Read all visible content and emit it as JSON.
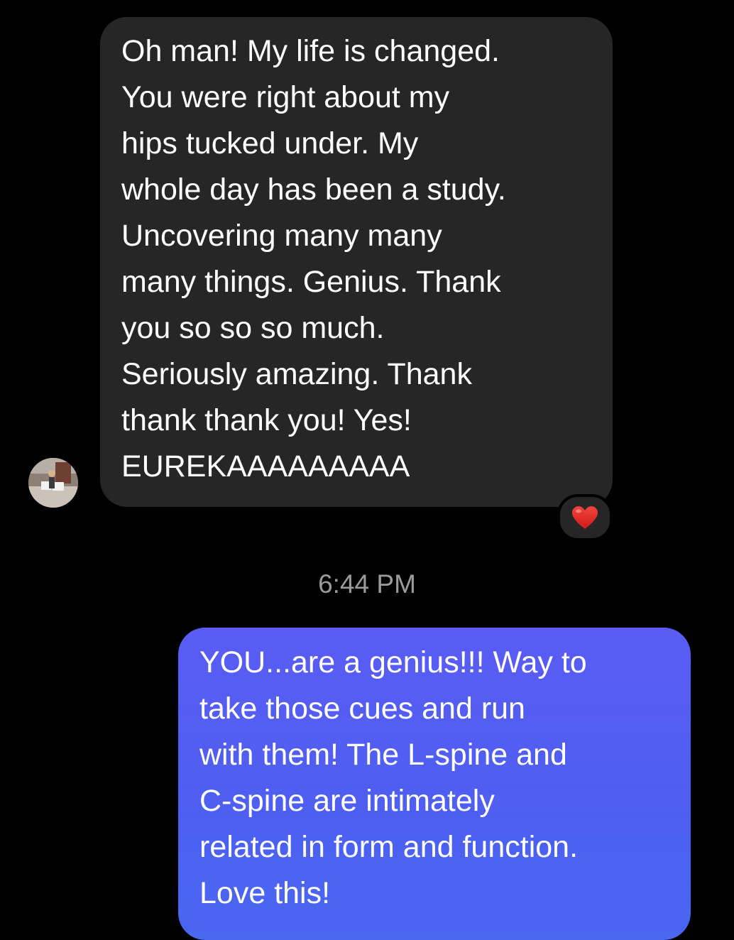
{
  "conversation": {
    "incoming_message": {
      "lines": [
        "Oh man! My life is changed.",
        "You were right about my",
        "hips tucked under. My",
        "whole day has been a study.",
        "Uncovering many many",
        "many things. Genius. Thank",
        "you so so so much.",
        "Seriously amazing. Thank",
        "thank thank you! Yes!",
        "EUREKAAAAAAAAA"
      ],
      "reaction": "heart-icon",
      "bubble_color": "#262626"
    },
    "timestamp": "6:44 PM",
    "outgoing_message": {
      "lines": [
        "YOU...are a genius!!! Way to",
        "take those cues and run",
        "with them! The L-spine and",
        "C-spine are intimately",
        "related in form and function.",
        "Love this!"
      ],
      "bubble_color": "#5a5cf4"
    }
  },
  "colors": {
    "background": "#000000",
    "timestamp_text": "#9b9b9b",
    "heart": "#e0201e"
  }
}
